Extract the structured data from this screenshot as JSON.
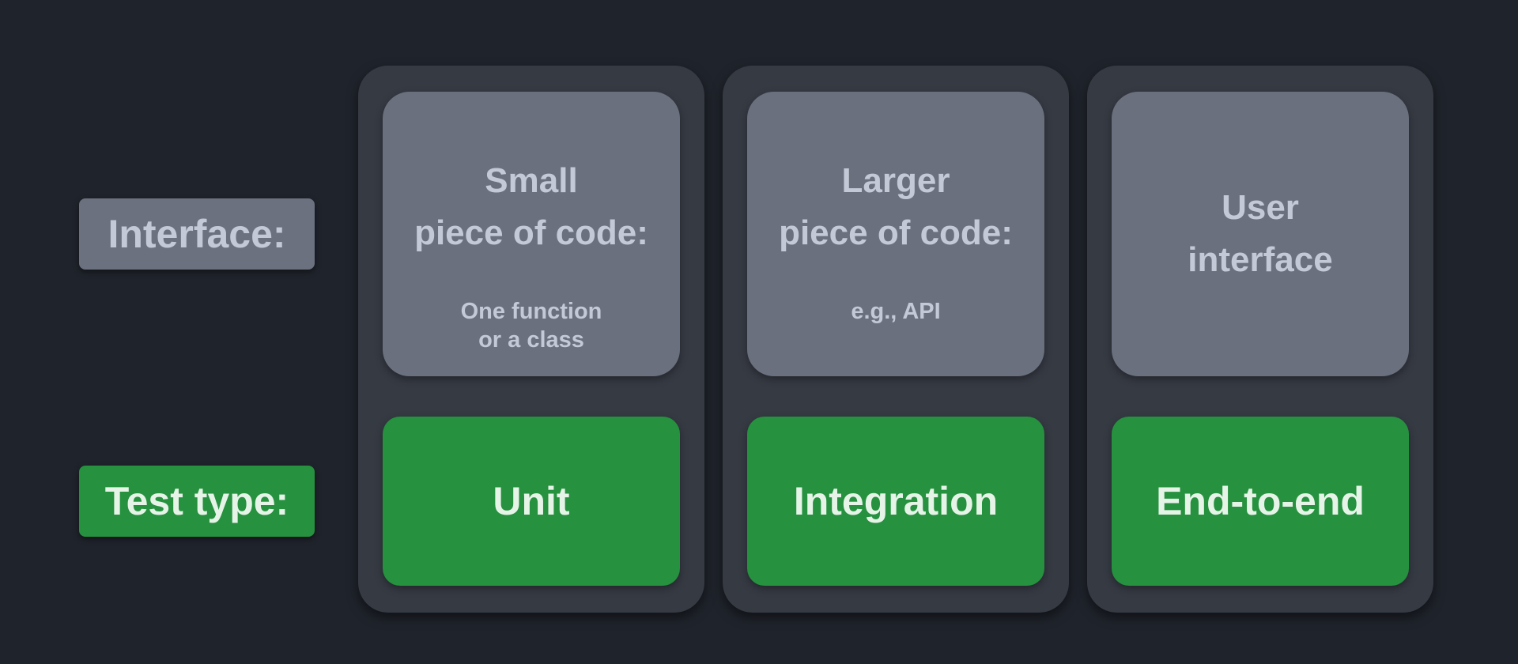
{
  "row_labels": {
    "interface": "Interface:",
    "test_type": "Test type:"
  },
  "columns": [
    {
      "interface_title": "Small\npiece of code:",
      "interface_detail": "One function\nor a class",
      "test_type": "Unit"
    },
    {
      "interface_title": "Larger\npiece of code:",
      "interface_detail": "e.g., API",
      "test_type": "Integration"
    },
    {
      "interface_title": "User\ninterface",
      "interface_detail": "",
      "test_type": "End-to-end"
    }
  ],
  "colors": {
    "background": "#1f232b",
    "column": "#363a43",
    "interface_box": "#6a707e",
    "interface_text": "#c3c9d6",
    "test_box": "#26913f",
    "test_text": "#e6f4e8"
  }
}
